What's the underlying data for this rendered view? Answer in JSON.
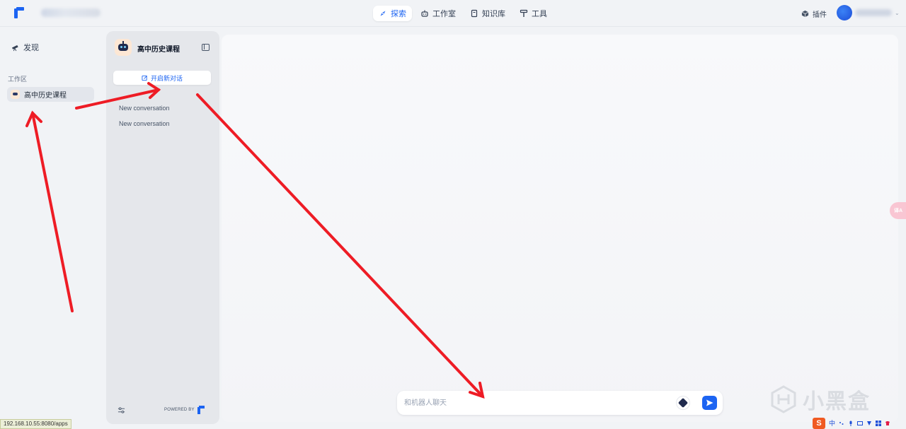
{
  "header": {
    "nav": [
      {
        "label": "探索",
        "icon": "compass-icon",
        "active": true
      },
      {
        "label": "工作室",
        "icon": "robot-icon",
        "active": false
      },
      {
        "label": "知识库",
        "icon": "book-icon",
        "active": false
      },
      {
        "label": "工具",
        "icon": "hammer-icon",
        "active": false
      }
    ],
    "plugins_label": "插件"
  },
  "sidebar": {
    "discover_label": "发现",
    "workspace_label": "工作区",
    "apps": [
      {
        "label": "高中历史课程"
      }
    ]
  },
  "conversation_panel": {
    "app_title": "高中历史课程",
    "new_chat_label": "开启新对话",
    "conversations": [
      {
        "label": "New conversation"
      },
      {
        "label": "New conversation"
      }
    ],
    "powered_by": "POWERED BY"
  },
  "chat": {
    "input_placeholder": "和机器人聊天"
  },
  "browser": {
    "status_url": "192.168.10.55:8080/apps"
  },
  "overlay": {
    "watermark_text": "小黑盒",
    "translate_label": "译A",
    "tray_ime": "中",
    "tray_logo": "S"
  },
  "colors": {
    "accent": "#1c64f2",
    "annotation_arrow": "#ee1c25"
  }
}
